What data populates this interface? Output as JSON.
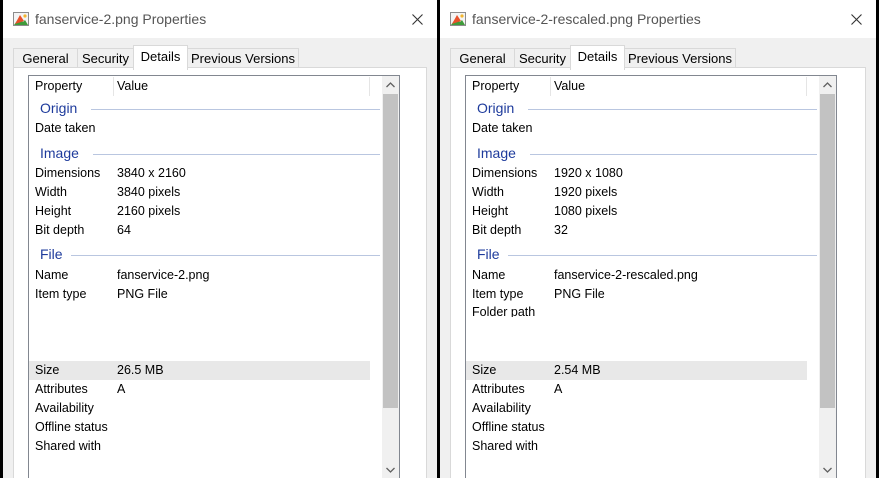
{
  "colors": {
    "accent": "#1e3b9c",
    "selection": "#e8e8e8",
    "thumb": "#c2c2c2"
  },
  "windows": [
    {
      "title": "fanservice-2.png Properties",
      "tabs": [
        "General",
        "Security",
        "Details",
        "Previous Versions"
      ],
      "active_tab": "Details",
      "columns": {
        "property": "Property",
        "value": "Value"
      },
      "groups": {
        "origin": {
          "label": "Origin",
          "rows": [
            {
              "k": "Date taken",
              "v": ""
            }
          ]
        },
        "image": {
          "label": "Image",
          "rows": [
            {
              "k": "Dimensions",
              "v": "3840 x 2160"
            },
            {
              "k": "Width",
              "v": "3840 pixels"
            },
            {
              "k": "Height",
              "v": "2160 pixels"
            },
            {
              "k": "Bit depth",
              "v": "64"
            }
          ]
        },
        "file": {
          "label": "File",
          "rows": [
            {
              "k": "Name",
              "v": "fanservice-2.png"
            },
            {
              "k": "Item type",
              "v": "PNG File"
            },
            {
              "k": "",
              "v": ""
            },
            {
              "k": "",
              "v": ""
            },
            {
              "k": "",
              "v": ""
            },
            {
              "k": "",
              "v": ""
            },
            {
              "k": "Size",
              "v": "26.5 MB"
            },
            {
              "k": "Attributes",
              "v": "A"
            },
            {
              "k": "Availability",
              "v": ""
            },
            {
              "k": "Offline status",
              "v": ""
            },
            {
              "k": "Shared with",
              "v": ""
            }
          ]
        }
      },
      "selected_row": "Size"
    },
    {
      "title": "fanservice-2-rescaled.png Properties",
      "tabs": [
        "General",
        "Security",
        "Details",
        "Previous Versions"
      ],
      "active_tab": "Details",
      "columns": {
        "property": "Property",
        "value": "Value"
      },
      "groups": {
        "origin": {
          "label": "Origin",
          "rows": [
            {
              "k": "Date taken",
              "v": ""
            }
          ]
        },
        "image": {
          "label": "Image",
          "rows": [
            {
              "k": "Dimensions",
              "v": "1920 x 1080"
            },
            {
              "k": "Width",
              "v": "1920 pixels"
            },
            {
              "k": "Height",
              "v": "1080 pixels"
            },
            {
              "k": "Bit depth",
              "v": "32"
            }
          ]
        },
        "file": {
          "label": "File",
          "rows": [
            {
              "k": "Name",
              "v": "fanservice-2-rescaled.png"
            },
            {
              "k": "Item type",
              "v": "PNG File"
            },
            {
              "k": "Folder path",
              "v": ""
            },
            {
              "k": "",
              "v": ""
            },
            {
              "k": "",
              "v": ""
            },
            {
              "k": "",
              "v": ""
            },
            {
              "k": "Size",
              "v": "2.54 MB"
            },
            {
              "k": "Attributes",
              "v": "A"
            },
            {
              "k": "Availability",
              "v": ""
            },
            {
              "k": "Offline status",
              "v": ""
            },
            {
              "k": "Shared with",
              "v": ""
            }
          ]
        }
      },
      "selected_row": "Size"
    }
  ]
}
